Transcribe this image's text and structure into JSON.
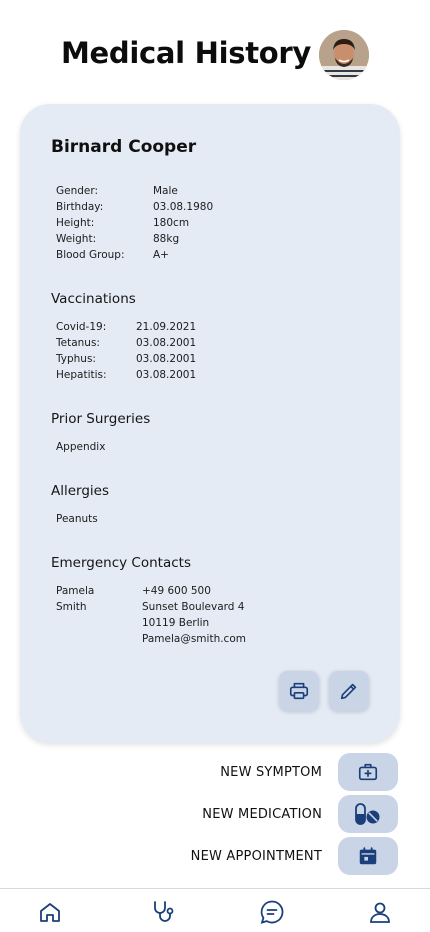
{
  "header": {
    "title": "Medical History"
  },
  "patient": {
    "name": "Birnard Cooper",
    "details": [
      {
        "label": "Gender:",
        "value": "Male"
      },
      {
        "label": "Birthday:",
        "value": "03.08.1980"
      },
      {
        "label": "Height:",
        "value": "180cm"
      },
      {
        "label": "Weight:",
        "value": "88kg"
      },
      {
        "label": "Blood Group:",
        "value": "A+"
      }
    ]
  },
  "vaccinations": {
    "title": "Vaccinations",
    "items": [
      {
        "label": "Covid-19:",
        "value": "21.09.2021"
      },
      {
        "label": "Tetanus:",
        "value": "03.08.2001"
      },
      {
        "label": "Typhus:",
        "value": "03.08.2001"
      },
      {
        "label": "Hepatitis:",
        "value": "03.08.2001"
      }
    ]
  },
  "surgeries": {
    "title": "Prior Surgeries",
    "items": [
      "Appendix"
    ]
  },
  "allergies": {
    "title": "Allergies",
    "items": [
      "Peanuts"
    ]
  },
  "emergency": {
    "title": "Emergency Contacts",
    "first_name": "Pamela",
    "last_name": "Smith",
    "phone": "+49 600 500",
    "street": "Sunset Boulevard 4",
    "city": "10119 Berlin",
    "email": "Pamela@smith.com"
  },
  "actions": {
    "symptom": "NEW SYMPTOM",
    "medication": "NEW MEDICATION",
    "appointment": "NEW APPOINTMENT"
  },
  "icons": {
    "print": "printer-icon",
    "edit": "pencil-icon",
    "symptom": "medical-kit-icon",
    "medication": "pills-icon",
    "appointment": "calendar-icon",
    "nav": [
      "home-icon",
      "stethoscope-icon",
      "chat-icon",
      "user-icon"
    ]
  },
  "colors": {
    "accent": "#1b3f7a",
    "card": "#e4ebf5",
    "button": "#c9d5e7"
  }
}
